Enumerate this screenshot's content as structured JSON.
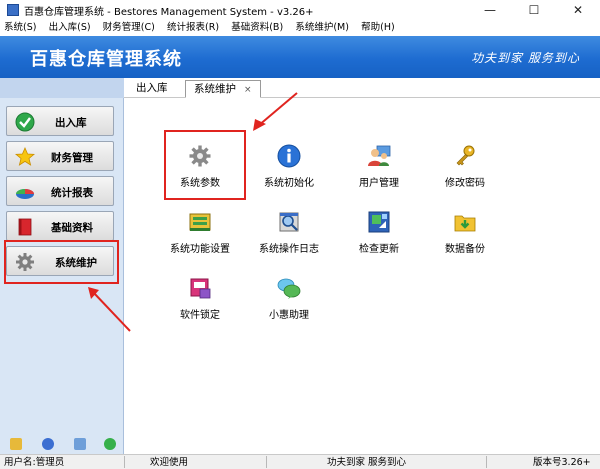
{
  "window": {
    "title": "百惠仓库管理系统 - Bestores Management System - v3.26+",
    "minimize_glyph": "—",
    "maximize_glyph": "☐",
    "close_glyph": "✕"
  },
  "menu": [
    "系统(S)",
    "出入库(S)",
    "财务管理(C)",
    "统计报表(R)",
    "基础资料(B)",
    "系统维护(M)",
    "帮助(H)"
  ],
  "banner": {
    "app_name": "百惠仓库管理系统",
    "slogan": "功夫到家 服务到心",
    "color_top": "#3f8be0",
    "color_bottom": "#1661c4"
  },
  "sidebar": {
    "items": [
      {
        "label": "出入库",
        "icon": "green-check-icon"
      },
      {
        "label": "财务管理",
        "icon": "star-icon"
      },
      {
        "label": "统计报表",
        "icon": "pie-chart-icon"
      },
      {
        "label": "基础资料",
        "icon": "red-book-icon"
      },
      {
        "label": "系统维护",
        "icon": "gear-icon"
      }
    ],
    "selected": "系统维护",
    "bottom_icons": [
      "help-icon",
      "clock-icon",
      "monitor-icon",
      "back-icon"
    ]
  },
  "tabs": {
    "items": [
      {
        "label": "出入库"
      },
      {
        "label": "系统维护",
        "close_glyph": "×"
      }
    ],
    "active": "系统维护"
  },
  "functions": [
    {
      "label": "系统参数",
      "icon": "gear-icon"
    },
    {
      "label": "系统初始化",
      "icon": "info-icon"
    },
    {
      "label": "用户管理",
      "icon": "users-icon"
    },
    {
      "label": "修改密码",
      "icon": "key-icon"
    },
    {
      "label": "系统功能设置",
      "icon": "settings-box-icon"
    },
    {
      "label": "系统操作日志",
      "icon": "log-magnifier-icon"
    },
    {
      "label": "检查更新",
      "icon": "update-icon"
    },
    {
      "label": "数据备份",
      "icon": "folder-download-icon"
    },
    {
      "label": "软件锁定",
      "icon": "lock-icon"
    },
    {
      "label": "小惠助理",
      "icon": "chat-icon"
    }
  ],
  "highlighted_function": "系统参数",
  "statusbar": {
    "user": "用户名:管理员",
    "welcome": "欢迎使用",
    "slogan": "功夫到家 服务到心",
    "version": "版本号3.26+"
  },
  "annotation_color": "#e0241f"
}
